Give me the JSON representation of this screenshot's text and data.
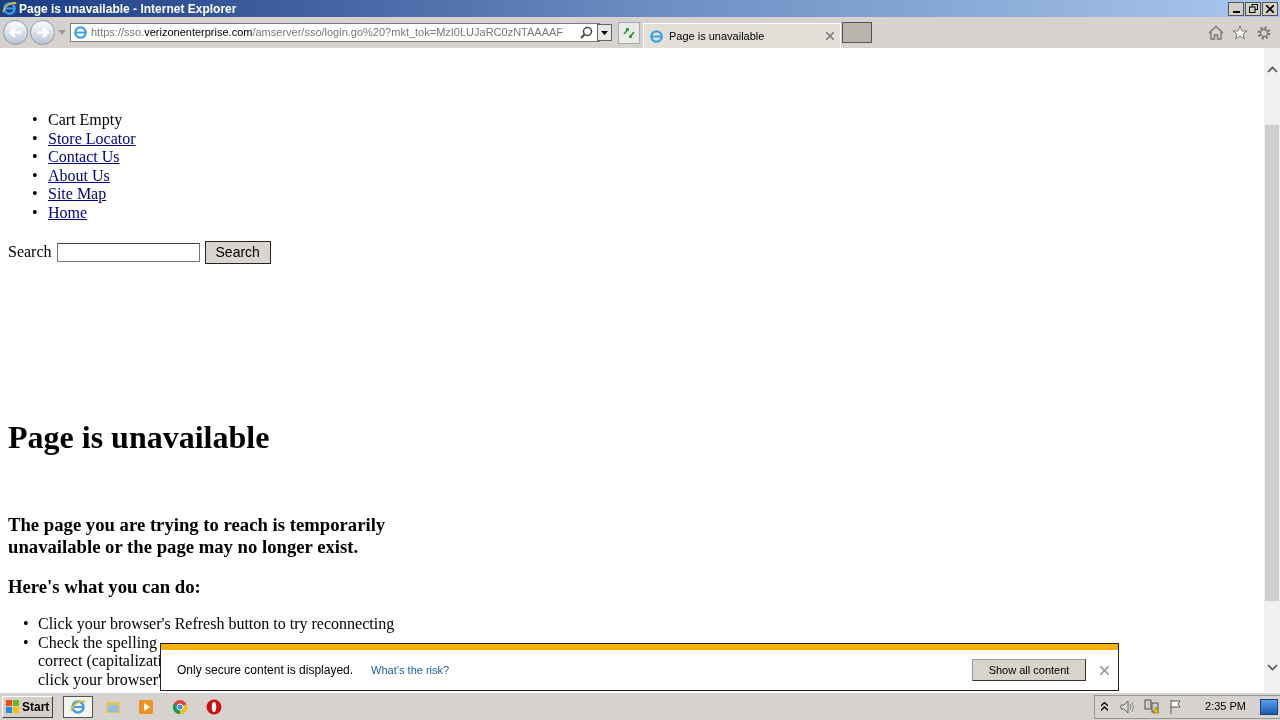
{
  "window": {
    "title": "Page is unavailable - Internet Explorer"
  },
  "address": {
    "prefix": "https://sso.",
    "host": "verizonenterprise.com",
    "path": "/amserver/sso/login.go%20?mkt_tok=MzI0LUJaRC0zNTAAAAF"
  },
  "tabs": [
    {
      "label": "Page is unavailable",
      "selected": true
    }
  ],
  "nav": [
    {
      "marker": "•",
      "label": "Cart Empty",
      "kind": "text"
    },
    {
      "marker": "•",
      "label": "Store Locator",
      "kind": "link"
    },
    {
      "marker": "•",
      "label": "Contact Us",
      "kind": "link"
    },
    {
      "marker": "•",
      "label": "About Us",
      "kind": "link"
    },
    {
      "marker": "•",
      "label": "Site Map",
      "kind": "link"
    },
    {
      "marker": "•",
      "label": "Home",
      "kind": "link"
    }
  ],
  "search": {
    "label": "Search",
    "button": "Search"
  },
  "heading": "Page is unavailable",
  "message": "The page you are trying to reach is temporarily unavailable or the page may no longer exist.",
  "subheading": "Here's what you can do:",
  "tips": [
    {
      "marker": "•",
      "lines": [
        "Click your browser's Refresh button to try reconnecting"
      ]
    },
    {
      "marker": "•",
      "lines": [
        "Check the spelling",
        "correct (capitalizati",
        "click your browser'"
      ]
    }
  ],
  "notification": {
    "message": "Only secure content is displayed.",
    "link": "What’s the risk?",
    "button": "Show all content"
  },
  "taskbar": {
    "start": "Start",
    "clock": "2:35 PM"
  }
}
